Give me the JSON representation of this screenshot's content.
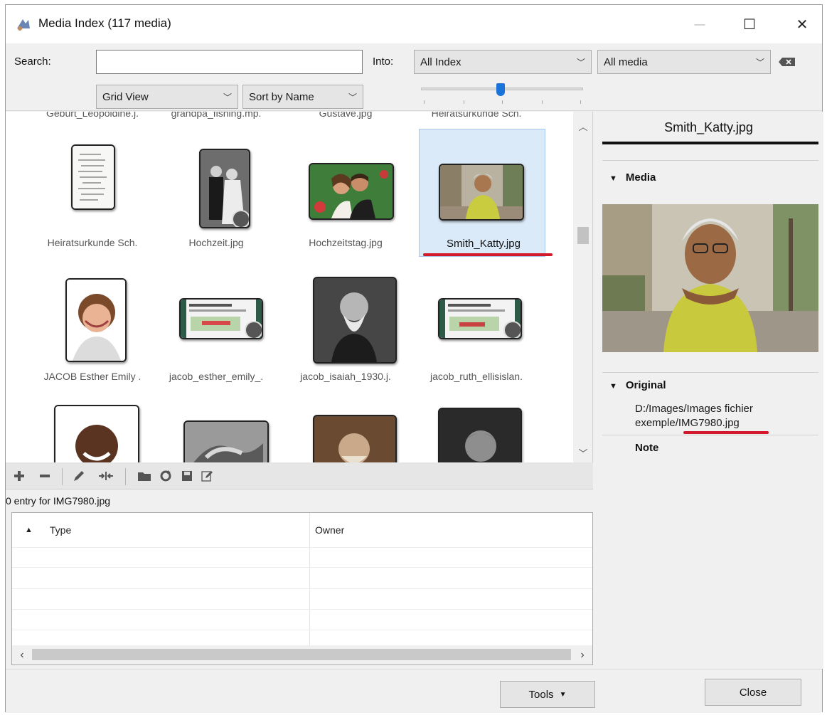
{
  "window": {
    "title": "Media Index (117 media)",
    "minimize_glyph": "—",
    "maximize_glyph": "☐",
    "close_glyph": "✕"
  },
  "filters": {
    "search_label": "Search:",
    "search_value": "",
    "into_label": "Into:",
    "into_value": "All Index",
    "media_type_value": "All media",
    "view_mode_value": "Grid View",
    "sort_value": "Sort by Name",
    "thumbnail_size_level": 0.5
  },
  "grid": {
    "partial_top_captions": [
      "Geburt_Leopoldine.j.",
      "grandpa_fishing.mp.",
      "Gustave.jpg",
      "Heiratsurkunde Sch."
    ],
    "rows": [
      [
        "Heiratsurkunde Sch.",
        "Hochzeit.jpg",
        "Hochzeitstag.jpg",
        "Smith_Katty.jpg"
      ],
      [
        "JACOB Esther Emily .",
        "jacob_esther_emily_.",
        "jacob_isaiah_1930.j.",
        "jacob_ruth_ellisislan."
      ]
    ],
    "selected": "Smith_Katty.jpg"
  },
  "actions": {
    "entry_count": "0 entry for IMG7980.jpg",
    "icons": [
      "add-icon",
      "remove-icon",
      "edit-icon",
      "merge-icon",
      "folder-icon",
      "refresh-icon",
      "save-icon",
      "edit-note-icon"
    ]
  },
  "table": {
    "columns": [
      "Type",
      "Owner"
    ],
    "sort_glyph": "▲"
  },
  "detail": {
    "title": "Smith_Katty.jpg",
    "media_section": "Media",
    "original_section": "Original",
    "original_path_line1": "D:/Images/Images fichier",
    "original_path_line2": "exemple/IMG7980.jpg",
    "note_section": "Note"
  },
  "buttons": {
    "tools": "Tools",
    "close": "Close"
  },
  "colors": {
    "accent_blue": "#1a73d8",
    "highlight_red": "#d21a2a",
    "selection_bg": "#dbeaf9"
  }
}
